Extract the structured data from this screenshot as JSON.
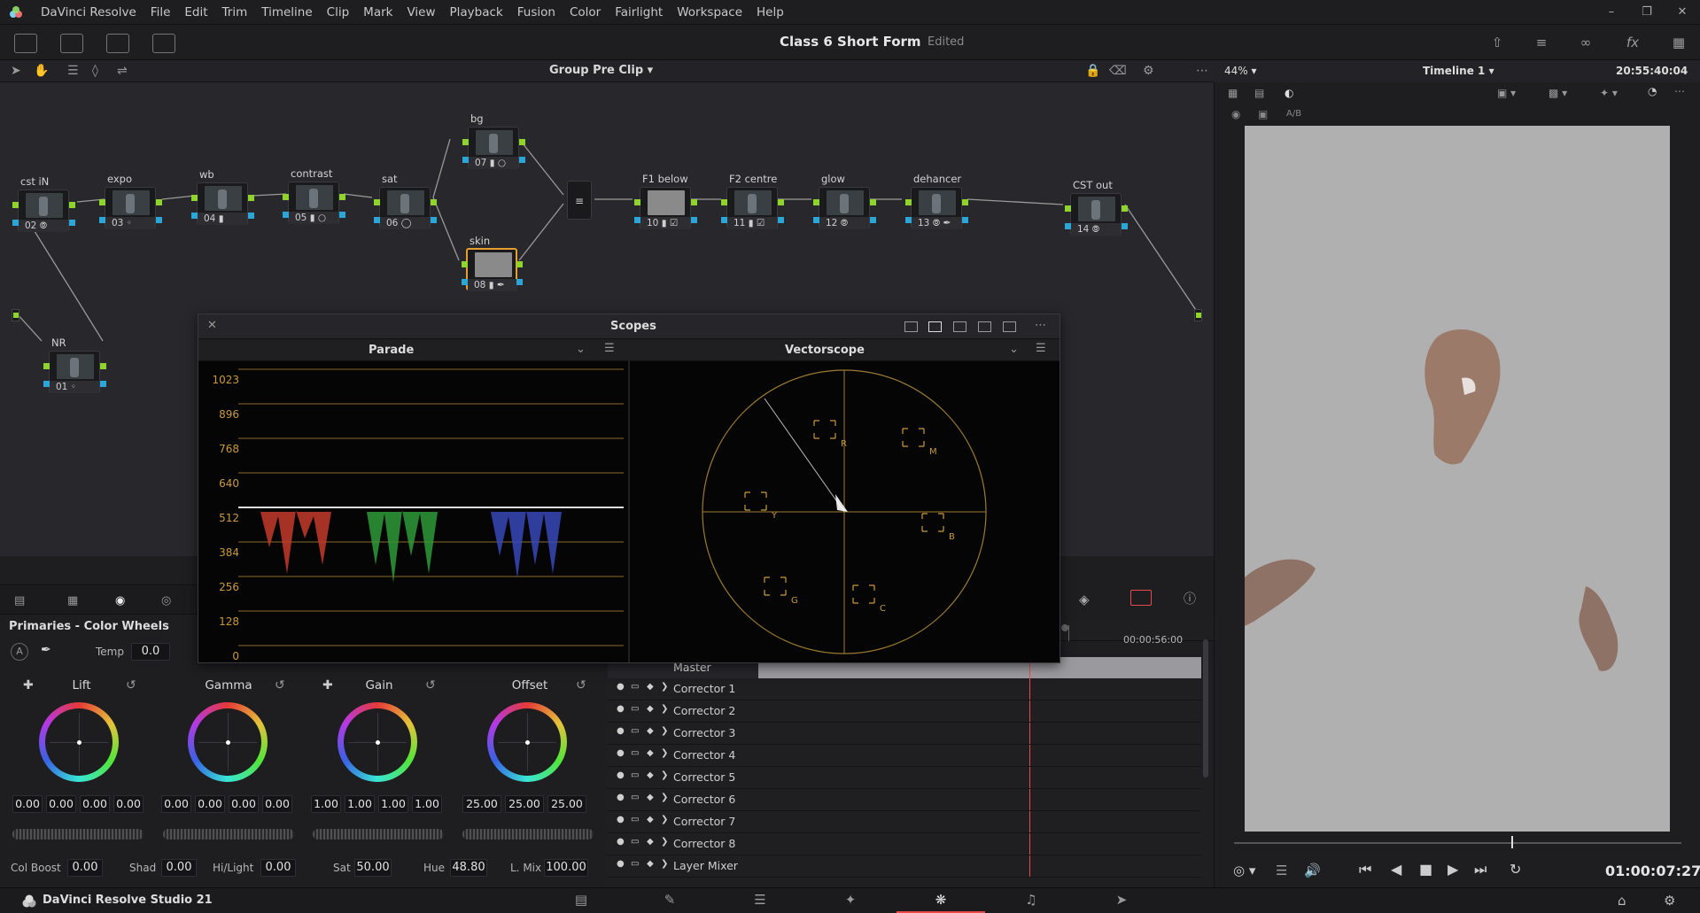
{
  "app": {
    "name": "DaVinci Resolve",
    "menus": [
      "DaVinci Resolve",
      "File",
      "Edit",
      "Trim",
      "Timeline",
      "Clip",
      "Mark",
      "View",
      "Playback",
      "Fusion",
      "Color",
      "Fairlight",
      "Workspace",
      "Help"
    ],
    "project_title": "Class 6 Short Form",
    "project_status": "Edited",
    "footer_name": "DaVinci Resolve Studio 21"
  },
  "nodegraph": {
    "title": "Group Pre Clip",
    "nodes": [
      {
        "label": "cst iN",
        "num": "02"
      },
      {
        "label": "expo",
        "num": "03"
      },
      {
        "label": "wb",
        "num": "04"
      },
      {
        "label": "contrast",
        "num": "05"
      },
      {
        "label": "sat",
        "num": "06"
      },
      {
        "label": "bg",
        "num": "07"
      },
      {
        "label": "skin",
        "num": "08"
      },
      {
        "label": "F1 below",
        "num": "10"
      },
      {
        "label": "F2 centre",
        "num": "11"
      },
      {
        "label": "glow",
        "num": "12"
      },
      {
        "label": "dehancer",
        "num": "13"
      },
      {
        "label": "CST out",
        "num": "14"
      },
      {
        "label": "NR",
        "num": "01"
      }
    ]
  },
  "scopes": {
    "title": "Scopes",
    "left": {
      "name": "Parade",
      "ticks": [
        "1023",
        "896",
        "768",
        "640",
        "512",
        "384",
        "256",
        "128",
        "0"
      ]
    },
    "right": {
      "name": "Vectorscope",
      "targets": [
        "R",
        "M",
        "Y",
        "B",
        "G",
        "C"
      ]
    }
  },
  "primaries": {
    "title": "Primaries - Color Wheels",
    "temp_label": "Temp",
    "temp_value": "0.0",
    "wheels": [
      {
        "name": "Lift",
        "values": [
          "0.00",
          "0.00",
          "0.00",
          "0.00"
        ]
      },
      {
        "name": "Gamma",
        "values": [
          "0.00",
          "0.00",
          "0.00",
          "0.00"
        ]
      },
      {
        "name": "Gain",
        "values": [
          "1.00",
          "1.00",
          "1.00",
          "1.00"
        ]
      },
      {
        "name": "Offset",
        "values": [
          "25.00",
          "25.00",
          "25.00"
        ]
      }
    ],
    "bottom": [
      {
        "label": "Col Boost",
        "value": "0.00"
      },
      {
        "label": "Shad",
        "value": "0.00"
      },
      {
        "label": "Hi/Light",
        "value": "0.00"
      },
      {
        "label": "Sat",
        "value": "50.00"
      },
      {
        "label": "Hue",
        "value": "48.80"
      },
      {
        "label": "L. Mix",
        "value": "100.00"
      }
    ]
  },
  "keyframes": {
    "master": "Master",
    "timecode": "00:00:56:00",
    "rows": [
      "Corrector 1",
      "Corrector 2",
      "Corrector 3",
      "Corrector 4",
      "Corrector 5",
      "Corrector 6",
      "Corrector 7",
      "Corrector 8",
      "Layer Mixer"
    ]
  },
  "viewer": {
    "zoom": "44%",
    "timeline": "Timeline 1",
    "timecode_top": "20:55:40:04",
    "ab_label": "A/B",
    "timecode_bottom": "01:00:07:27",
    "scrub_position": 0.62
  },
  "colors": {
    "accent": "#e84a4a",
    "node_green": "#8fd42b",
    "node_blue": "#2aa6d8",
    "scope_grid": "#c99a3c",
    "selected": "#e7a02f"
  }
}
